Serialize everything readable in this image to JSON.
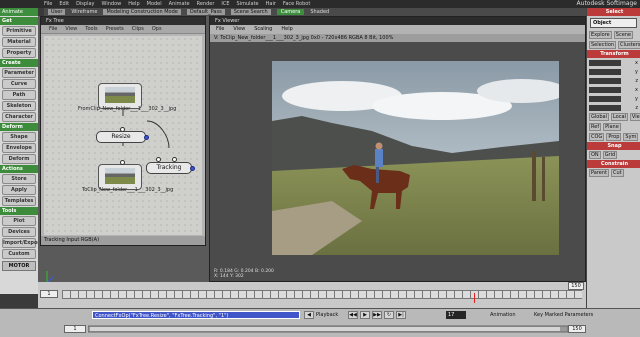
{
  "app": {
    "brand": "Autodesk Softimage",
    "menus": [
      "File",
      "Edit",
      "Display",
      "Window",
      "Help",
      "Model",
      "Animate",
      "Render",
      "ICE",
      "Simulate",
      "Hair",
      "Face Robot"
    ],
    "mode": "Animate",
    "toolbar": {
      "view_mode": "User",
      "construction": "Modeling Construction Mode",
      "preset": "Default_Pass",
      "search": "Scene Search",
      "wireframe": "Wireframe",
      "camera": "Camera",
      "shaded": "Shaded"
    }
  },
  "left_bar": {
    "sections": [
      {
        "title": "Get",
        "buttons": [
          "Primitive",
          "Material",
          "Property"
        ]
      },
      {
        "title": "Create",
        "buttons": [
          "Parameter",
          "Curve",
          "Path",
          "Skeleton",
          "Character"
        ]
      },
      {
        "title": "Deform",
        "buttons": [
          "Shape",
          "Envelope",
          "Deform"
        ]
      },
      {
        "title": "Actions",
        "buttons": [
          "Store",
          "Apply",
          "Templates"
        ]
      },
      {
        "title": "Tools",
        "buttons": [
          "Plot",
          "Devices",
          "Import/Export",
          "Custom"
        ]
      }
    ],
    "motor": "MOTOR"
  },
  "fx_tree": {
    "title": "Fx Tree",
    "menu": [
      "File",
      "View",
      "Tools",
      "Presets",
      "Clips",
      "Ops"
    ],
    "nodes": {
      "from_clip": "FromClip_New_folder___1___302_3__jpg",
      "resize": "Resize",
      "to_clip": "ToClip_New_folder___1___302_3__jpg",
      "tracking": "Tracking"
    },
    "status": "Tracking  Input RGB(A)"
  },
  "fx_viewer": {
    "title": "Fx Viewer",
    "menu": [
      "File",
      "View",
      "Scaling",
      "Help"
    ],
    "info": "V: ToClip_New_folder___1___302_3_jpg  0x0 - 720x486 RGBA 8 Bit, 100%",
    "readout": [
      "R: 0.184  G: 0.204  B: 0.200",
      "X: 144   Y: 302"
    ]
  },
  "timeline": {
    "start": "1",
    "end": "150",
    "current_frame": "150",
    "marker_frame": "120"
  },
  "command_bar": {
    "command": "ConnectFxOp(\"FxTree.Resize\", \"FxTree.Tracking\", \"1\")",
    "playback_label": "Playback",
    "frame": "17",
    "animation_label": "Animation",
    "key_label": "Key Marked Parameters",
    "range_start": "1",
    "range_end": "150"
  },
  "right_panel": {
    "select_header": "Select",
    "object_button": "Object",
    "explore_tabs": [
      "Explore",
      "Scene"
    ],
    "selection_tabs": [
      "Selection",
      "Clusters"
    ],
    "transform_header": "Transform",
    "axes": [
      "x",
      "y",
      "z",
      "x",
      "y",
      "z"
    ],
    "view_tabs": [
      "Global",
      "Local",
      "View"
    ],
    "sub_tabs": [
      "Ref",
      "Plane"
    ],
    "misc_tabs": [
      "COG",
      "Prop",
      "Sym"
    ],
    "snap_header": "Snap",
    "snap_tabs": [
      "ON",
      "Grid"
    ],
    "constrain_header": "Constrain",
    "constrain_tabs": [
      "Parent",
      "Cut"
    ]
  }
}
